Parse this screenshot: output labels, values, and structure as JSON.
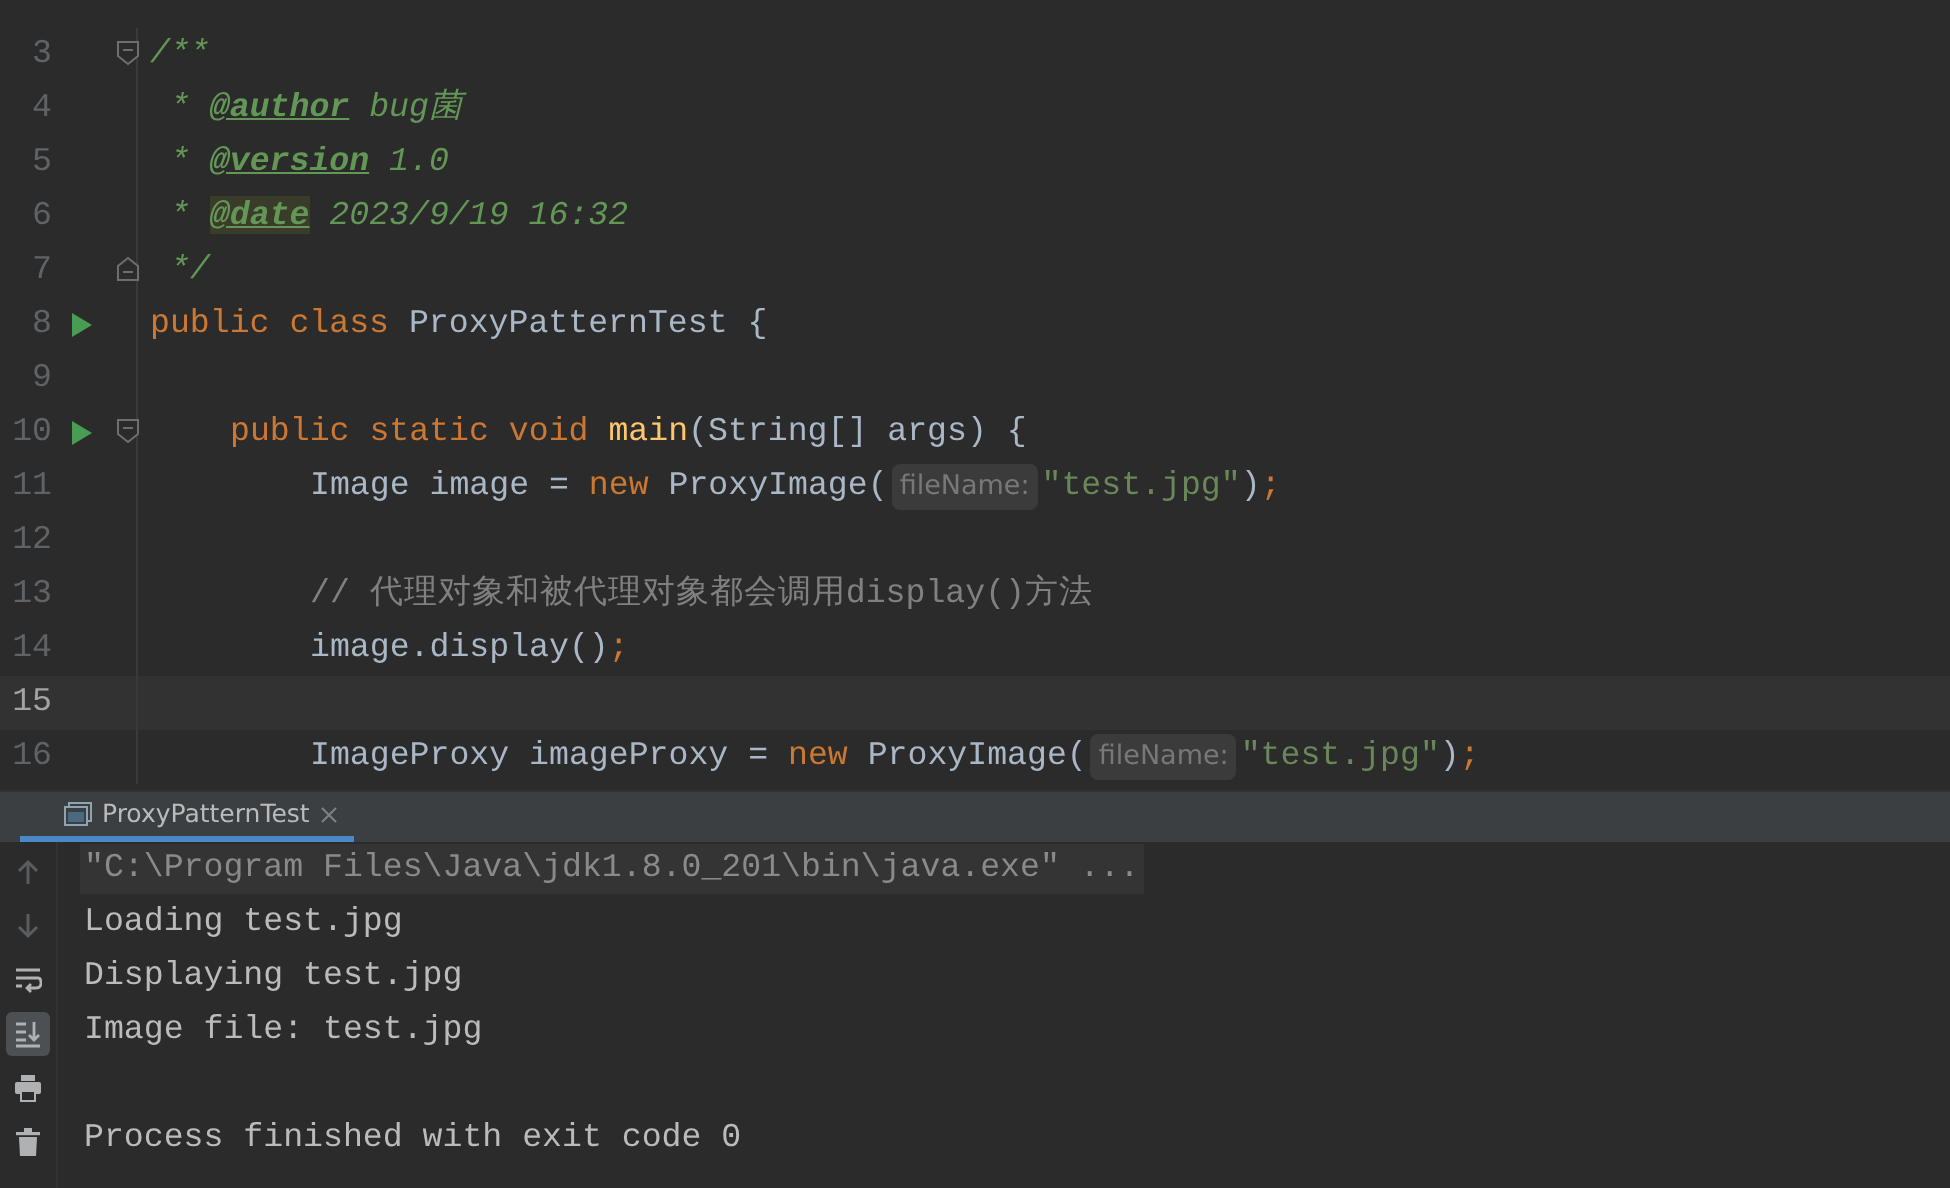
{
  "editor": {
    "lines": [
      {
        "number": "3",
        "run": false,
        "fold": {
          "kind": "start"
        },
        "current": false,
        "parts": [
          {
            "kind": "code",
            "tokens": [
              {
                "t": "/**",
                "kind": "doc"
              }
            ]
          }
        ]
      },
      {
        "number": "4",
        "run": false,
        "current": false,
        "kind": "doc",
        "parts": [
          {
            "kind": "code",
            "tokens": [
              {
                "t": "* ",
                "kind": "doc"
              },
              {
                "t": "@author",
                "kind": "doctag"
              },
              {
                "t": " bug菌",
                "kind": "doc"
              }
            ]
          }
        ]
      },
      {
        "number": "5",
        "run": false,
        "current": false,
        "kind": "doc",
        "parts": [
          {
            "kind": "code",
            "tokens": [
              {
                "t": "* ",
                "kind": "doc"
              },
              {
                "t": "@version",
                "kind": "doctag"
              },
              {
                "t": " 1.0",
                "kind": "doc"
              }
            ]
          }
        ]
      },
      {
        "number": "6",
        "run": false,
        "current": false,
        "kind": "doc",
        "parts": [
          {
            "kind": "code",
            "tokens": [
              {
                "t": "* ",
                "kind": "doc"
              },
              {
                "t": "@date",
                "kind": "doctag-marked"
              },
              {
                "t": " 2023/9/19 16:32",
                "kind": "doc"
              }
            ]
          }
        ]
      },
      {
        "number": "7",
        "run": false,
        "fold": {
          "kind": "end"
        },
        "current": false,
        "kind": "doc",
        "parts": [
          {
            "kind": "code",
            "tokens": [
              {
                "t": "*/",
                "kind": "doc"
              }
            ]
          }
        ]
      },
      {
        "number": "8",
        "run": true,
        "current": false,
        "parts": [
          {
            "kind": "code",
            "tokens": [
              {
                "t": "public class ",
                "kind": "keyword"
              },
              {
                "t": "ProxyPatternTest {",
                "kind": "plain"
              }
            ]
          }
        ]
      },
      {
        "number": "9",
        "run": false,
        "current": false
      },
      {
        "number": "10",
        "run": true,
        "fold": {
          "kind": "start"
        },
        "current": false,
        "kind": "member",
        "parts": [
          {
            "kind": "code",
            "tokens": [
              {
                "t": "public static void ",
                "kind": "keyword"
              },
              {
                "t": "main",
                "kind": "method"
              },
              {
                "t": "(String[] args) {",
                "kind": "plain"
              }
            ]
          }
        ]
      },
      {
        "number": "11",
        "run": false,
        "current": false,
        "kind": "body",
        "parts": [
          {
            "kind": "code",
            "tokens": [
              {
                "t": "Image image = ",
                "kind": "plain"
              },
              {
                "t": "new ",
                "kind": "keyword"
              },
              {
                "t": "ProxyImage(",
                "kind": "plain"
              }
            ]
          },
          {
            "kind": "hint",
            "text": "fileName:"
          },
          {
            "kind": "code",
            "tokens": [
              {
                "t": "\"test.jpg\"",
                "kind": "string"
              },
              {
                "t": ")",
                "kind": "plain"
              },
              {
                "t": ";",
                "kind": "keyword"
              }
            ]
          }
        ]
      },
      {
        "number": "12",
        "run": false,
        "current": false
      },
      {
        "number": "13",
        "run": false,
        "current": false,
        "kind": "body",
        "parts": [
          {
            "kind": "code",
            "tokens": [
              {
                "t": "// 代理对象和被代理对象都会调用display()方法",
                "kind": "comment"
              }
            ]
          }
        ]
      },
      {
        "number": "14",
        "run": false,
        "current": false,
        "kind": "body",
        "parts": [
          {
            "kind": "code",
            "tokens": [
              {
                "t": "image.display()",
                "kind": "plain"
              },
              {
                "t": ";",
                "kind": "keyword"
              }
            ]
          }
        ]
      },
      {
        "number": "15",
        "run": false,
        "current": true
      },
      {
        "number": "16",
        "run": false,
        "current": false,
        "kind": "body",
        "parts": [
          {
            "kind": "code",
            "tokens": [
              {
                "t": "ImageProxy imageProxy = ",
                "kind": "plain"
              },
              {
                "t": "new ",
                "kind": "keyword"
              },
              {
                "t": "ProxyImage(",
                "kind": "plain"
              }
            ]
          },
          {
            "kind": "hint",
            "text": "fileName:"
          },
          {
            "kind": "code",
            "tokens": [
              {
                "t": "\"test.jpg\"",
                "kind": "string"
              },
              {
                "t": ")",
                "kind": "plain"
              },
              {
                "t": ";",
                "kind": "keyword"
              }
            ]
          }
        ]
      }
    ]
  },
  "run_panel": {
    "tabs": [
      {
        "label": "ProxyPatternTest",
        "selected": true
      }
    ],
    "toolbar": [
      {
        "kind": "up",
        "disabled": true,
        "selected": false
      },
      {
        "kind": "down",
        "disabled": true,
        "selected": false
      },
      {
        "kind": "wrap",
        "disabled": false,
        "selected": false
      },
      {
        "kind": "scroll-end",
        "disabled": false,
        "selected": true
      },
      {
        "kind": "print",
        "disabled": false,
        "selected": false
      },
      {
        "kind": "trash",
        "disabled": false,
        "selected": false
      }
    ],
    "output": [
      {
        "text": "\"C:\\Program Files\\Java\\jdk1.8.0_201\\bin\\java.exe\" ...",
        "kind": "command"
      },
      {
        "text": "Loading test.jpg",
        "kind": "stdout"
      },
      {
        "text": "Displaying test.jpg",
        "kind": "stdout"
      },
      {
        "text": "Image file: test.jpg",
        "kind": "stdout"
      },
      {
        "kind": "blank"
      },
      {
        "text": "Process finished with exit code 0",
        "kind": "stdout"
      }
    ]
  }
}
